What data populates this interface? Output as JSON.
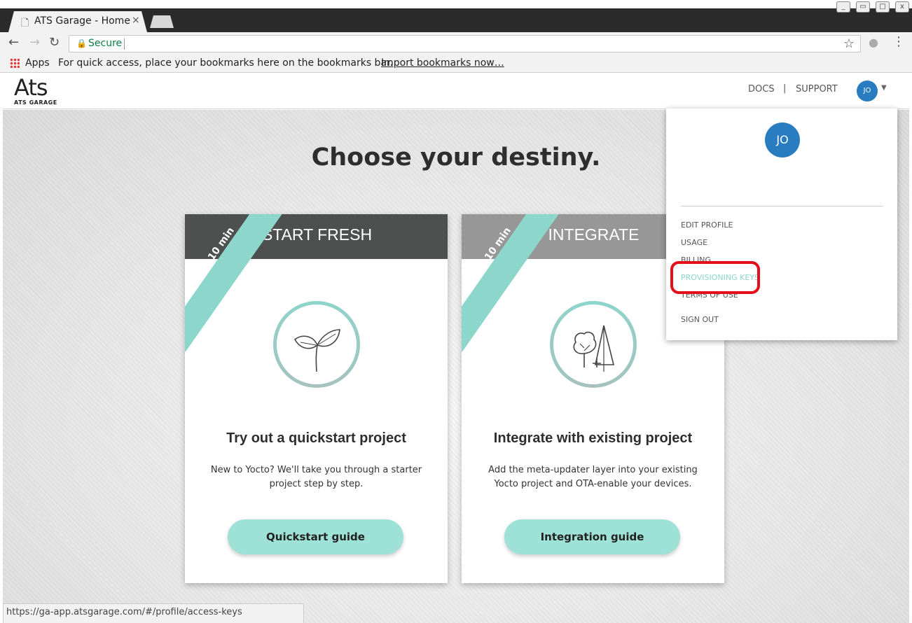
{
  "browser": {
    "tab_title": "ATS Garage - Home",
    "tab_close": "×",
    "security_label": "Secure",
    "bookmarks": {
      "apps_label": "Apps",
      "message": "For quick access, place your bookmarks here on the bookmarks bar.",
      "import_link": "Import bookmarks now…"
    },
    "status_url": "https://ga-app.atsgarage.com/#/profile/access-keys"
  },
  "header": {
    "logo_mark": "Ats",
    "logo_sub": "ATS GARAGE",
    "nav": {
      "docs": "DOCS",
      "separator": "|",
      "support": "SUPPORT"
    },
    "avatar_initials": "JO"
  },
  "main": {
    "headline": "Choose your destiny.",
    "cards": [
      {
        "header": "START FRESH",
        "header_color": "#4e5050",
        "ribbon": "10 min",
        "subtitle": "Try out a quickstart project",
        "description": "New to Yocto? We'll take you through a starter project step by step.",
        "button": "Quickstart guide",
        "icon": "sprout-icon"
      },
      {
        "header": "INTEGRATE",
        "header_color": "#979797",
        "ribbon": "10 min",
        "subtitle": "Integrate with existing project",
        "description": "Add the meta-updater layer into your existing Yocto project and OTA-enable your devices.",
        "button": "Integration guide",
        "icon": "trees-icon"
      }
    ]
  },
  "dropdown": {
    "avatar_initials": "JO",
    "items": {
      "edit_profile": "EDIT PROFILE",
      "usage": "USAGE",
      "billing": "BILLING",
      "provisioning_keys": "PROVISIONING KEYS",
      "terms_of_use": "TERMS OF USE",
      "sign_out": "SIGN OUT"
    }
  },
  "colors": {
    "accent": "#8cd6cc",
    "button": "#9ee1d7",
    "avatar": "#2a7cc1",
    "highlight": "#e3101c"
  }
}
